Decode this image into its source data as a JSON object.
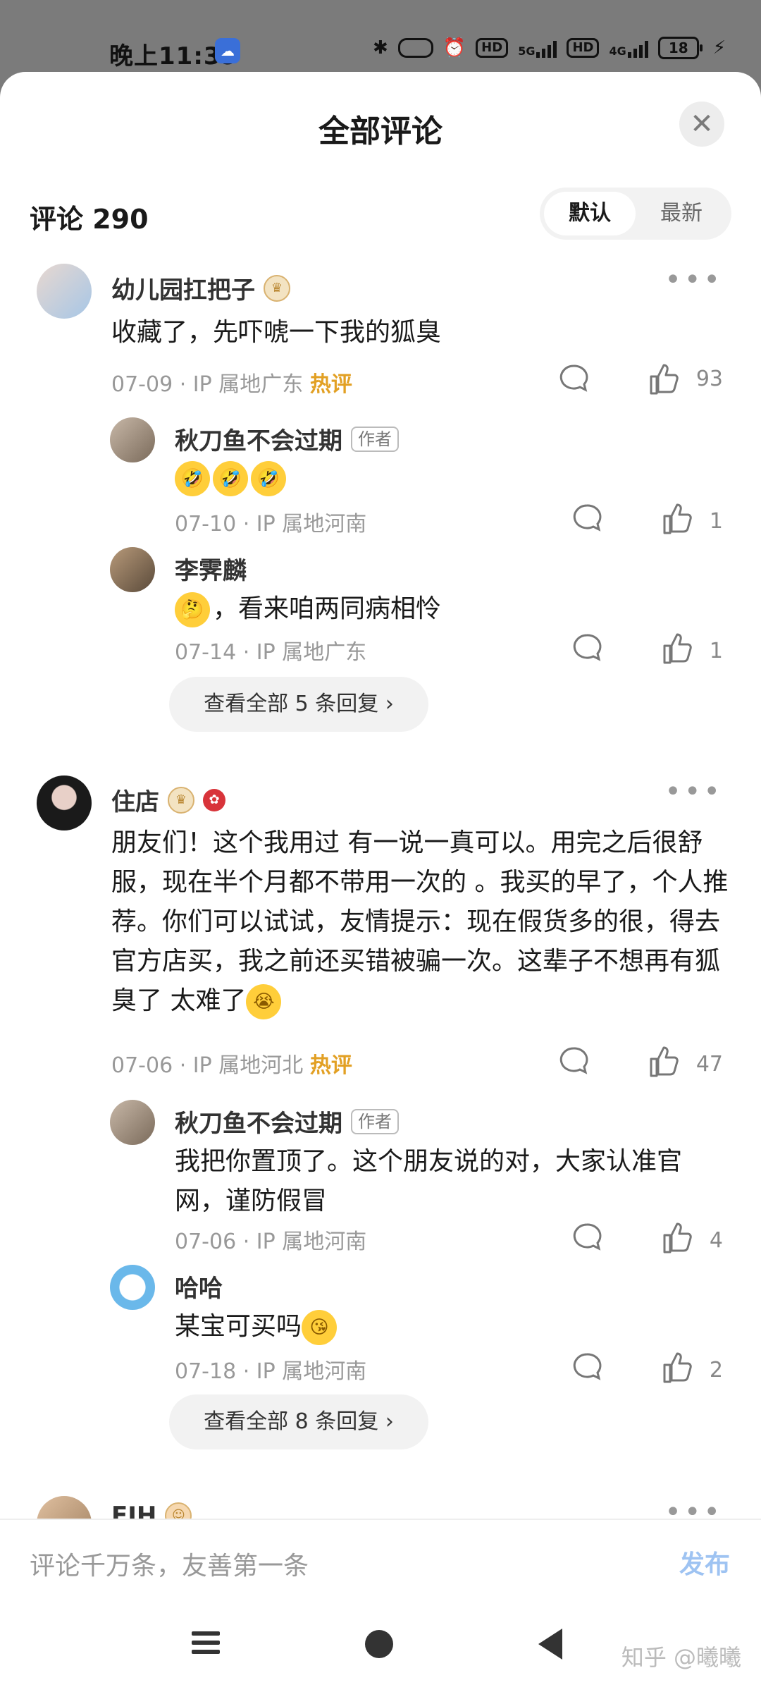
{
  "status_bar": {
    "time": "晚上11:39",
    "app_icon": "app-notification-icon",
    "hd1": "HD",
    "net1": "5G",
    "hd2": "HD",
    "net2": "4G",
    "battery": "18"
  },
  "sheet": {
    "title": "全部评论",
    "close_icon": "close-icon"
  },
  "header": {
    "count_label": "评论 290",
    "sort_default": "默认",
    "sort_latest": "最新"
  },
  "comments": [
    {
      "name": "幼儿园扛把子",
      "text": "收藏了，先吓唬一下我的狐臭",
      "date": "07-09",
      "location": "IP 属地广东",
      "hot": "热评",
      "likes": "93",
      "replies": [
        {
          "name": "秋刀鱼不会过期",
          "tag": "作者",
          "text": "",
          "date": "07-10",
          "location": "IP 属地河南",
          "likes": "1"
        },
        {
          "name": "李霁麟",
          "text": "，看来咱两同病相怜",
          "date": "07-14",
          "location": "IP 属地广东",
          "likes": "1"
        }
      ],
      "more_replies": "查看全部 5 条回复"
    },
    {
      "name": "住店",
      "text": "朋友们！这个我用过 有一说一真可以。用完之后很舒服，现在半个月都不带用一次的 。我买的早了，个人推荐。你们可以试试，友情提示：现在假货多的很，得去官方店买，我之前还买错被骗一次。这辈子不想再有狐臭了 太难了",
      "date": "07-06",
      "location": "IP 属地河北",
      "hot": "热评",
      "likes": "47",
      "replies": [
        {
          "name": "秋刀鱼不会过期",
          "tag": "作者",
          "text": "我把你置顶了。这个朋友说的对，大家认准官网，谨防假冒",
          "date": "07-06",
          "location": "IP 属地河南",
          "likes": "4"
        },
        {
          "name": "哈哈",
          "text": "某宝可买吗",
          "date": "07-18",
          "location": "IP 属地河南",
          "likes": "2"
        }
      ],
      "more_replies": "查看全部 8 条回复"
    },
    {
      "name": "FJH"
    }
  ],
  "input": {
    "placeholder": "评论千万条，友善第一条",
    "publish": "发布"
  },
  "watermark": "知乎 @曦曦"
}
